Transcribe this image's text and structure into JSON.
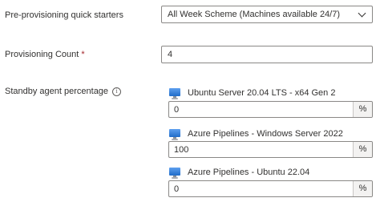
{
  "quick_starters": {
    "label": "Pre-provisioning quick starters",
    "selected": "All Week Scheme (Machines available 24/7)"
  },
  "provisioning_count": {
    "label": "Provisioning Count",
    "required_mark": "*",
    "value": "4"
  },
  "standby": {
    "label": "Standby agent percentage",
    "info_glyph": "i",
    "agents": [
      {
        "name": "Ubuntu Server 20.04 LTS - x64 Gen 2",
        "value": "0",
        "suffix": "%"
      },
      {
        "name": "Azure Pipelines - Windows Server 2022",
        "value": "100",
        "suffix": "%"
      },
      {
        "name": "Azure Pipelines - Ubuntu 22.04",
        "value": "0",
        "suffix": "%"
      }
    ]
  },
  "icons": {
    "info": "info-icon",
    "dropdown": "chevron-down-icon",
    "agent": "monitor-icon"
  },
  "colors": {
    "border": "#8a8886",
    "text": "#323130",
    "required": "#a4262c",
    "monitor": "#1f6cc9",
    "suffix_bg": "#f3f2f1"
  }
}
